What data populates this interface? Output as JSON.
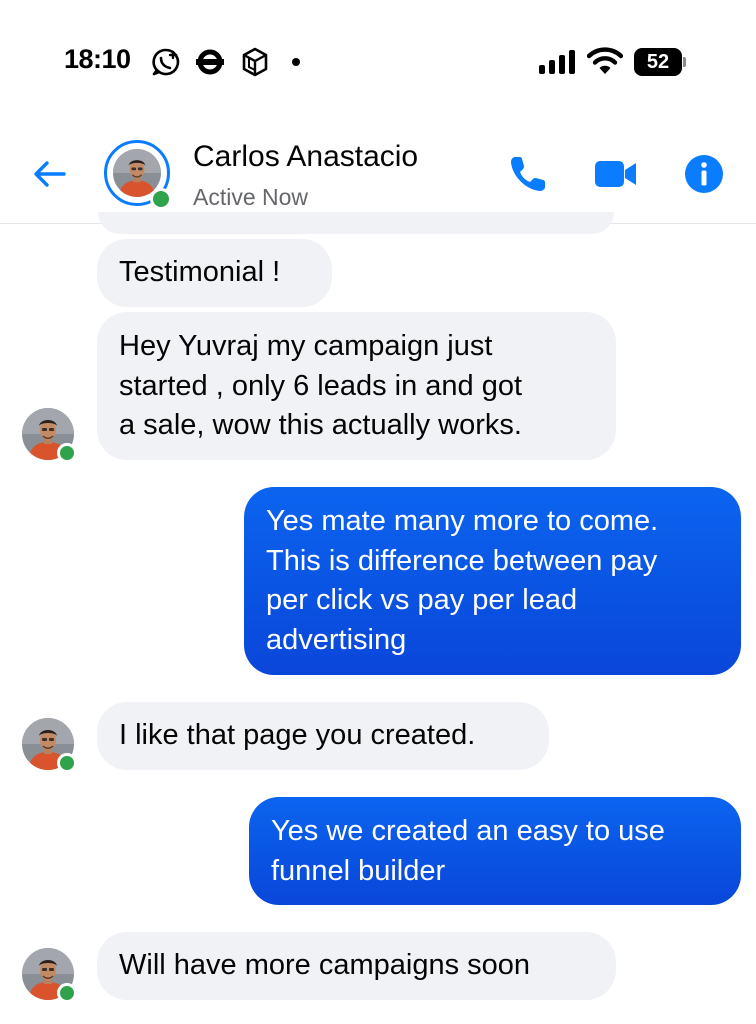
{
  "status_bar": {
    "time": "18:10",
    "battery": "52",
    "icons": [
      "whatsapp-icon",
      "london-underground-icon",
      "cube-icon",
      "dot-icon",
      "cellular-signal-icon",
      "wifi-icon",
      "battery-icon"
    ]
  },
  "header": {
    "contact_name": "Carlos Anastacio",
    "status": "Active Now",
    "icons": [
      "back-arrow-icon",
      "phone-icon",
      "video-camera-icon",
      "info-icon"
    ],
    "accent_color": "#0a7cff"
  },
  "messages": [
    {
      "from": "contact",
      "text": "Testimonial !"
    },
    {
      "from": "contact",
      "lines": [
        "Hey Yuvraj my campaign just",
        "started , only 6 leads in and got",
        "a sale, wow this actually works."
      ]
    },
    {
      "from": "me",
      "lines": [
        "Yes mate many more to come.",
        "This is difference between pay",
        "per click vs pay per lead",
        "advertising"
      ]
    },
    {
      "from": "contact",
      "text": "I like that page you created."
    },
    {
      "from": "me",
      "lines": [
        "Yes we created an easy to use",
        "funnel builder"
      ]
    },
    {
      "from": "contact",
      "text": "Will have more campaigns soon"
    }
  ],
  "colors": {
    "incoming_bubble": "#f0f2f5",
    "outgoing_bubble": "#0a55e4",
    "online": "#31a24c"
  }
}
